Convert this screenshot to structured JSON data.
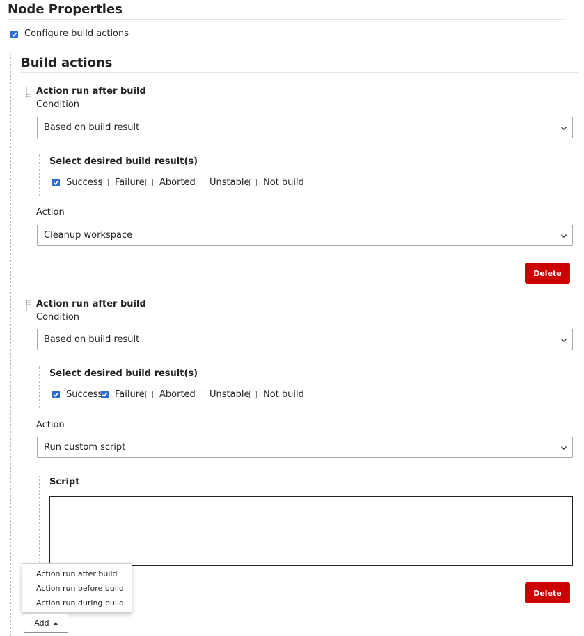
{
  "page": {
    "title": "Node Properties",
    "configure_label": "Configure build actions",
    "configure_checked": true
  },
  "build_actions": {
    "title": "Build actions",
    "items": [
      {
        "header": "Action run after build",
        "condition_label": "Condition",
        "condition_value": "Based on build result",
        "results_title": "Select desired build result(s)",
        "results": [
          {
            "label": "Success",
            "checked": true
          },
          {
            "label": "Failure",
            "checked": false
          },
          {
            "label": "Aborted",
            "checked": false
          },
          {
            "label": "Unstable",
            "checked": false
          },
          {
            "label": "Not build",
            "checked": false
          }
        ],
        "action_label": "Action",
        "action_value": "Cleanup workspace",
        "delete_label": "Delete"
      },
      {
        "header": "Action run after build",
        "condition_label": "Condition",
        "condition_value": "Based on build result",
        "results_title": "Select desired build result(s)",
        "results": [
          {
            "label": "Success",
            "checked": true
          },
          {
            "label": "Failure",
            "checked": true
          },
          {
            "label": "Aborted",
            "checked": false
          },
          {
            "label": "Unstable",
            "checked": false
          },
          {
            "label": "Not build",
            "checked": false
          }
        ],
        "action_label": "Action",
        "action_value": "Run custom script",
        "script_label": "Script",
        "script_value": "",
        "delete_label": "Delete"
      }
    ]
  },
  "add_menu": {
    "items": [
      "Action run after build",
      "Action run before build",
      "Action run during build"
    ],
    "button_label": "Add"
  },
  "colors": {
    "accent": "#2b6cd6",
    "danger": "#cc0000"
  },
  "icons": {
    "select_arrow": "chevron-down-icon",
    "drag": "drag-handle-icon",
    "add_caret": "caret-up-icon"
  }
}
